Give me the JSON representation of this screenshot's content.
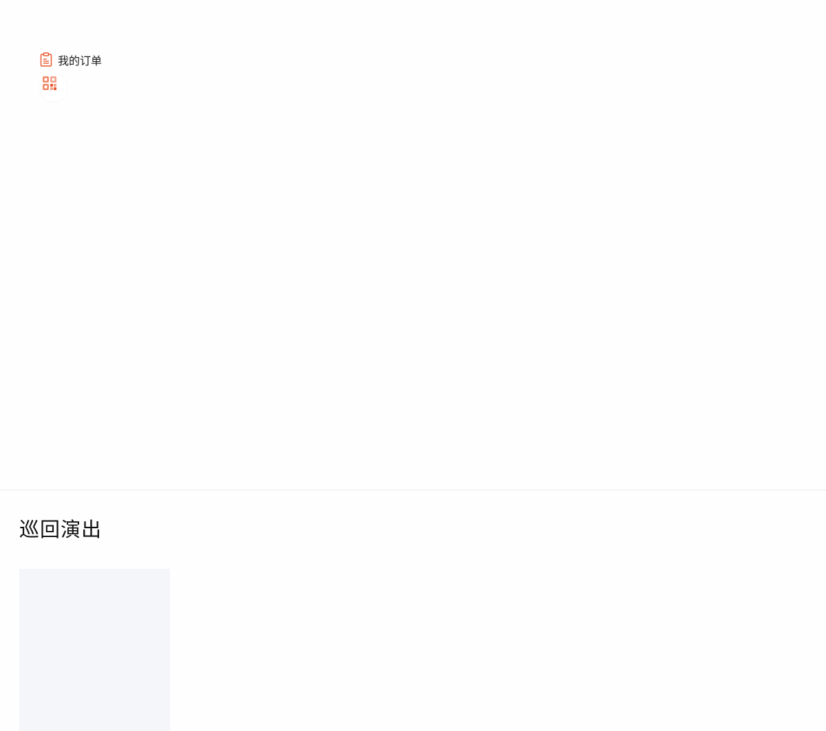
{
  "header": {
    "orders_label": "我的订单",
    "orders_icon": "clipboard-list-icon",
    "qr_icon": "qr-code-icon",
    "accent_color": "#e8572c"
  },
  "tours": {
    "section_title": "巡回演出",
    "cards": [
      {
        "placeholder": true
      }
    ]
  }
}
